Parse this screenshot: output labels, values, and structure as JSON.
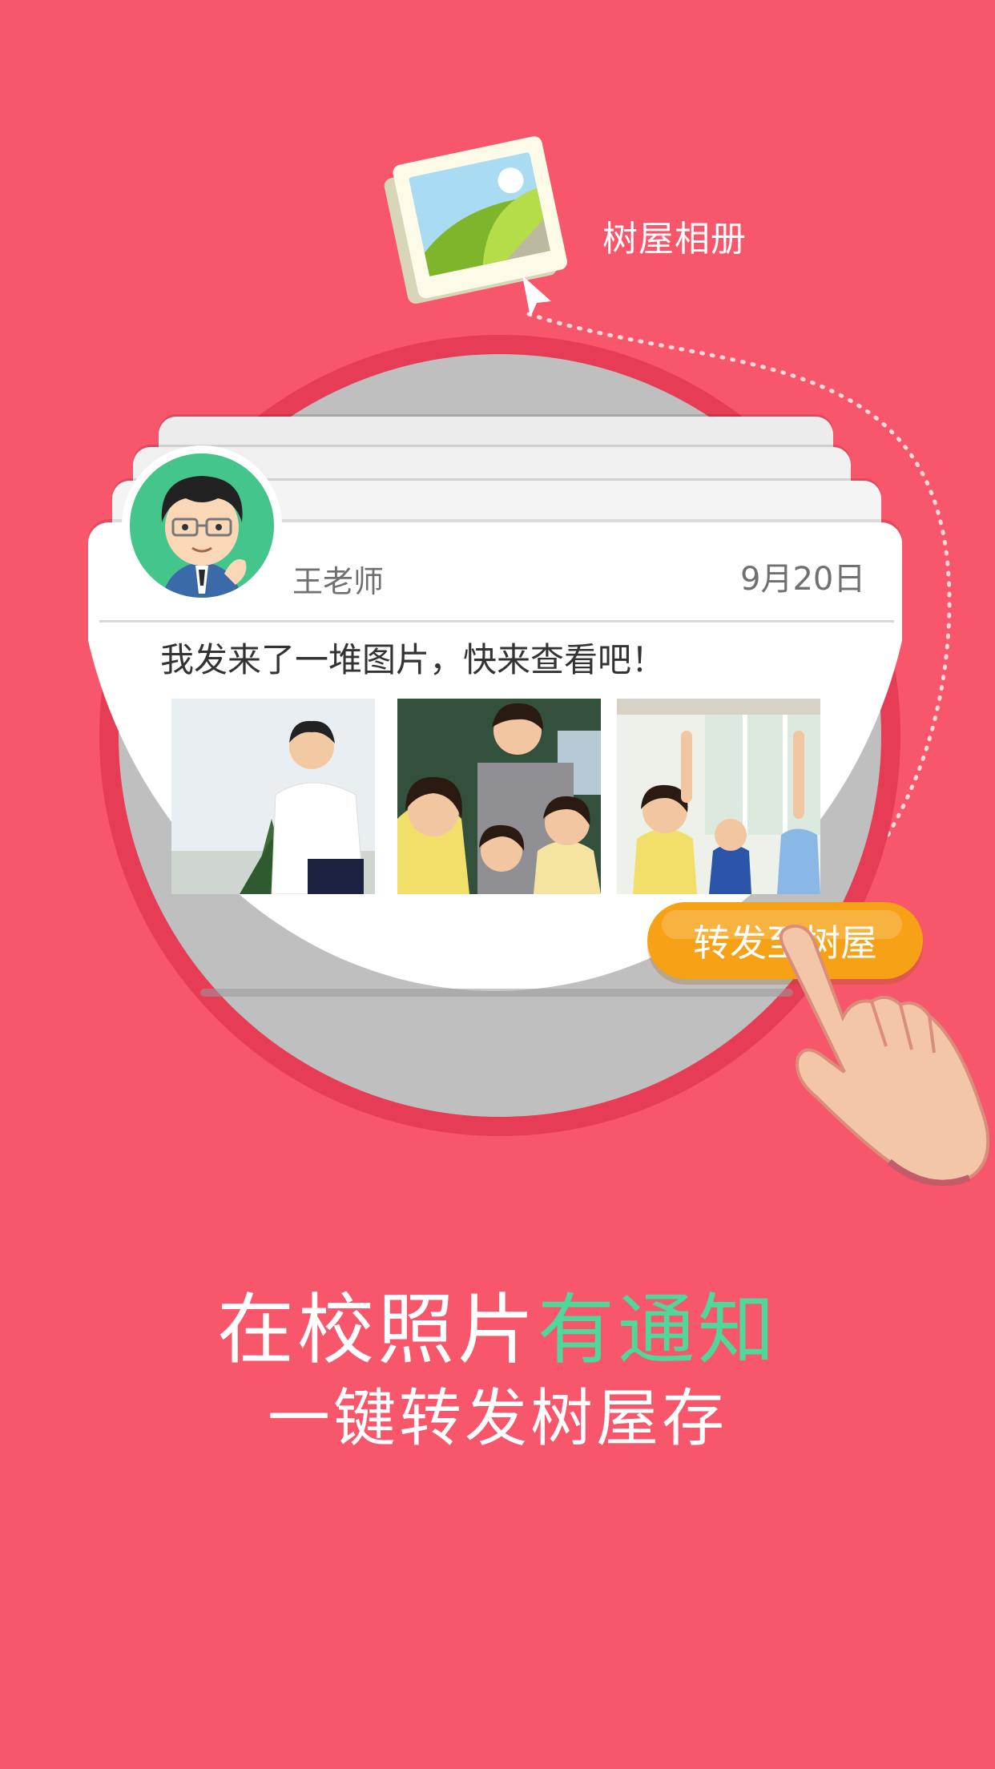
{
  "album": {
    "label": "树屋相册",
    "icon": "photo-album-icon"
  },
  "post": {
    "teacher": "王老师",
    "date": "9月20日",
    "text": "我发来了一堆图片，快来查看吧！",
    "photos": [
      "photo-boy-outdoors",
      "photo-students-classroom",
      "photo-kids-raising-hands"
    ]
  },
  "forward_button": {
    "label": "转发至树屋",
    "color": "#f7a116"
  },
  "headline": {
    "part1": "在校照片",
    "part2": "有通知",
    "accent_color": "#4fd89a"
  },
  "subheadline": "一键转发树屋存",
  "colors": {
    "background": "#f8566a",
    "circle": "#e63c55",
    "avatar_bg": "#44c58c"
  }
}
